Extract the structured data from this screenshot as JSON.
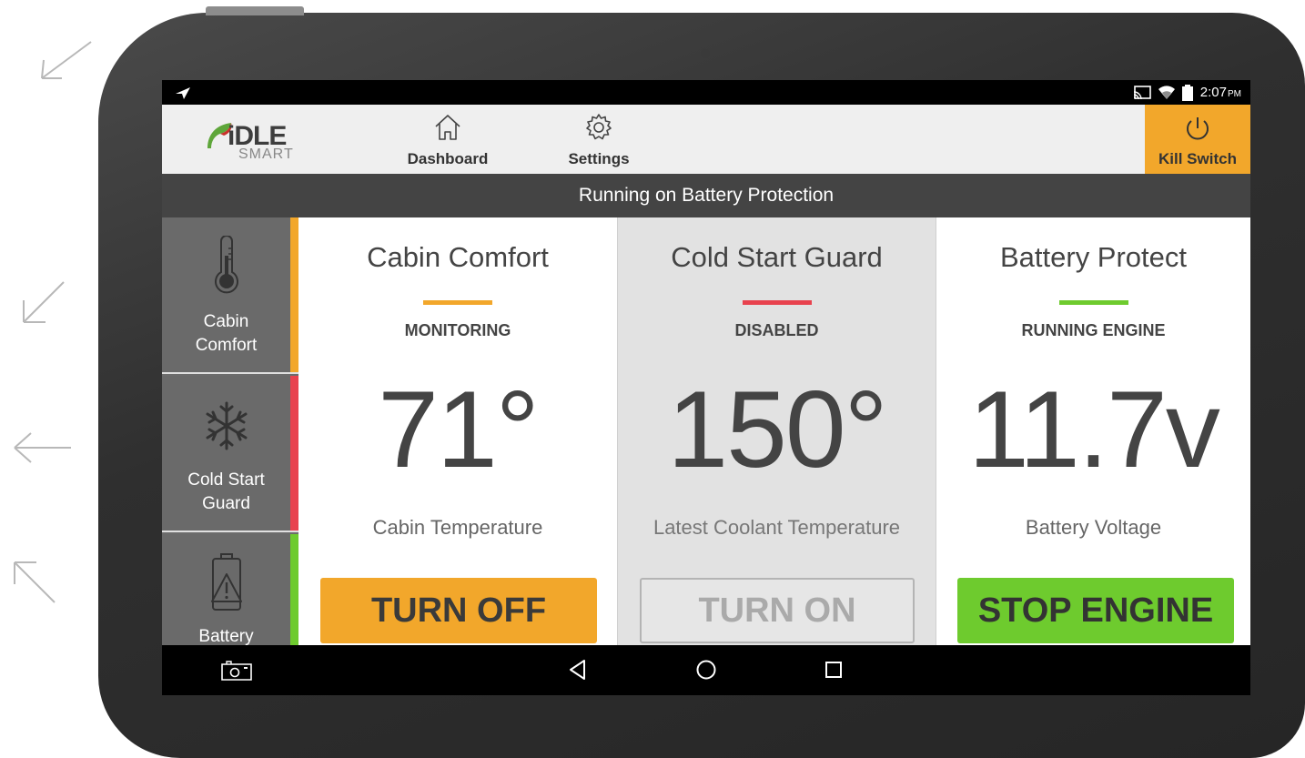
{
  "statusbar": {
    "time": "2:07",
    "ampm": "PM"
  },
  "logo": {
    "text": "DLE",
    "sub": "SMART"
  },
  "nav": [
    {
      "label": "Dashboard",
      "icon": "home-icon"
    },
    {
      "label": "Settings",
      "icon": "gear-icon"
    }
  ],
  "kill_switch": {
    "label": "Kill Switch",
    "icon": "power-icon"
  },
  "banner": {
    "text": "Running on Battery Protection"
  },
  "sidebar": {
    "items": [
      {
        "label": "Cabin Comfort",
        "icon": "thermometer-icon",
        "stripe": "#f2a72b"
      },
      {
        "label": "Cold Start Guard",
        "icon": "snowflake-icon",
        "stripe": "#e8424e"
      },
      {
        "label": "Battery",
        "icon": "battery-warning-icon",
        "stripe": "#6ecb2e"
      }
    ]
  },
  "panels": [
    {
      "title": "Cabin Comfort",
      "status": "MONITORING",
      "value": "71°",
      "caption": "Cabin Temperature",
      "action": "TURN OFF",
      "accent": "#f2a72b"
    },
    {
      "title": "Cold Start Guard",
      "status": "DISABLED",
      "value": "150°",
      "caption": "Latest Coolant Temperature",
      "action": "TURN ON",
      "accent": "#e8424e"
    },
    {
      "title": "Battery Protect",
      "status": "RUNNING ENGINE",
      "value": "11.7v",
      "caption": "Battery Voltage",
      "action": "STOP ENGINE",
      "accent": "#6ecb2e"
    }
  ],
  "system_nav": [
    "screenshot-icon",
    "back-icon",
    "home-circle-icon",
    "recents-icon"
  ]
}
